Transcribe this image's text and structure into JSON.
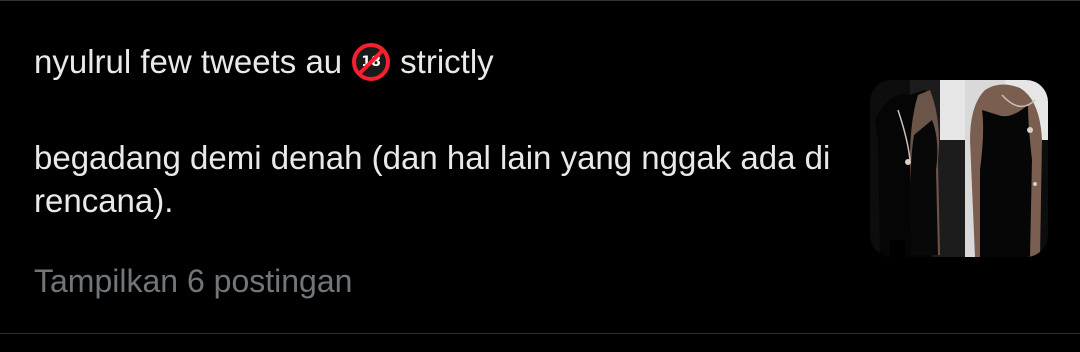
{
  "community": {
    "title_before": "nyulrul few tweets au",
    "badge_number": "18",
    "badge_icon": "under-18-prohibited-icon",
    "title_after": "strictly",
    "description": "begadang demi denah (dan hal lain yang nggak ada di rencana).",
    "footer": "Tampilkan 6 postingan",
    "thumbnail": "two people in black tank tops"
  },
  "colors": {
    "background": "#000000",
    "primary_text": "#e7e9ea",
    "secondary_text": "#71767b",
    "divider": "#2f3336",
    "badge_red": "#f4212e"
  }
}
